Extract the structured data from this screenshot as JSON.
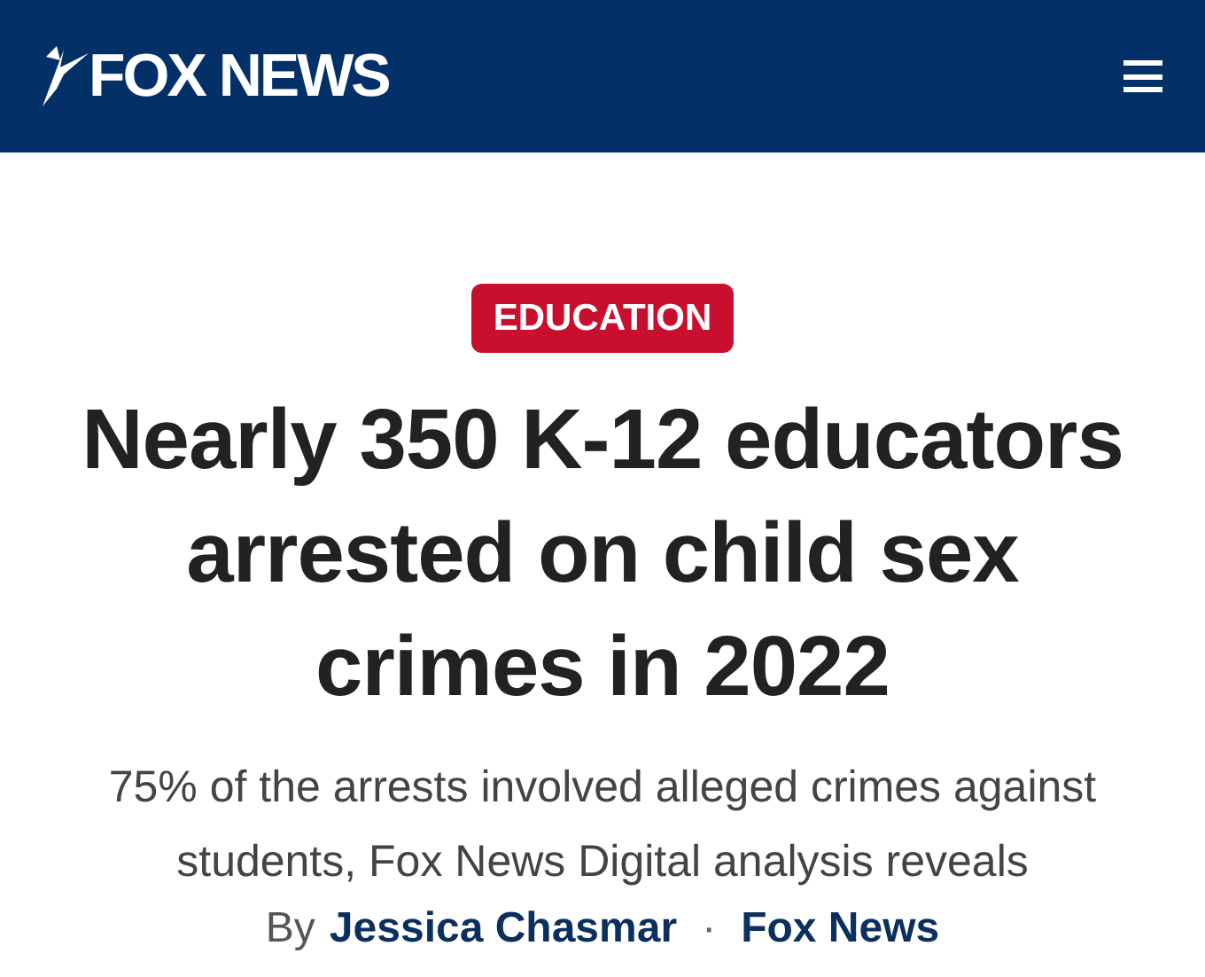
{
  "header": {
    "logo": "FOX NEWS"
  },
  "article": {
    "category": "EDUCATION",
    "headline": "Nearly 350 K-12 educators arrested on child sex crimes in 2022",
    "subheadline": "75% of the arrests involved alleged crimes against students, Fox News Digital analysis reveals",
    "byline": {
      "prefix": "By",
      "author": "Jessica Chasmar",
      "separator": "·",
      "source": "Fox News"
    }
  }
}
